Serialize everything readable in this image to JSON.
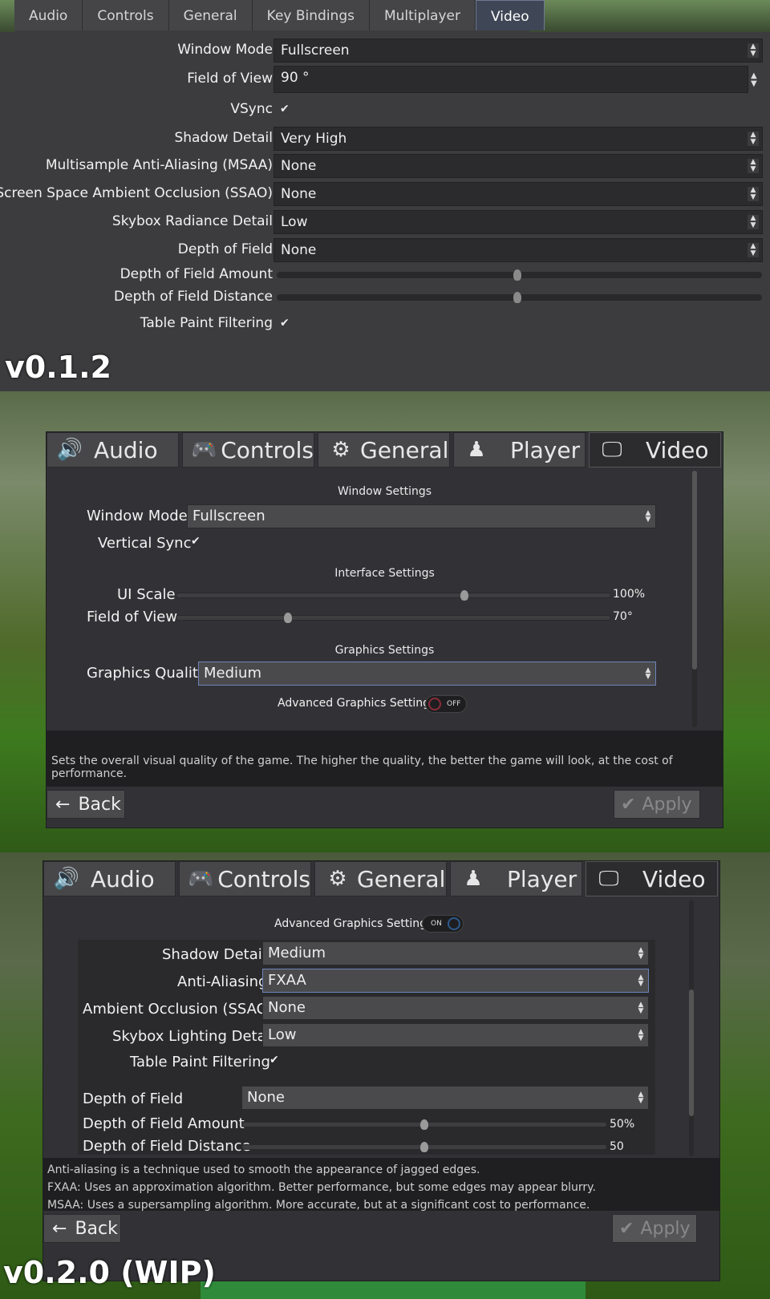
{
  "v1": {
    "tabs": [
      "Audio",
      "Controls",
      "General",
      "Key Bindings",
      "Multiplayer",
      "Video"
    ],
    "rows": {
      "window_mode": {
        "label": "Window Mode",
        "value": "Fullscreen"
      },
      "fov": {
        "label": "Field of View",
        "value": "90 °"
      },
      "vsync": {
        "label": "VSync",
        "checked": true
      },
      "shadow": {
        "label": "Shadow Detail",
        "value": "Very High"
      },
      "msaa": {
        "label": "Multisample Anti-Aliasing (MSAA)",
        "value": "None"
      },
      "ssao": {
        "label": "Screen Space Ambient Occlusion (SSAO)",
        "value": "None"
      },
      "skybox": {
        "label": "Skybox Radiance Detail",
        "value": "Low"
      },
      "dof": {
        "label": "Depth of Field",
        "value": "None"
      },
      "dof_amount": {
        "label": "Depth of Field Amount",
        "level": 0.5
      },
      "dof_distance": {
        "label": "Depth of Field Distance",
        "level": 0.5
      },
      "table_paint": {
        "label": "Table Paint Filtering",
        "checked": true
      }
    },
    "version": "v0.1.2"
  },
  "v2": {
    "tabs": [
      "Audio",
      "Controls",
      "General",
      "Player",
      "Video"
    ],
    "window_settings": "Window Settings",
    "window_mode": {
      "label": "Window Mode",
      "value": "Fullscreen"
    },
    "vsync": {
      "label": "Vertical Sync",
      "checked": true
    },
    "interface_settings": "Interface Settings",
    "ui_scale": {
      "label": "UI Scale",
      "value": "100%",
      "level": 0.66
    },
    "fov": {
      "label": "Field of View",
      "value": "70°",
      "level": 0.25
    },
    "graphics_settings": "Graphics Settings",
    "graphics_quality": {
      "label": "Graphics Quality",
      "value": "Medium"
    },
    "advanced": {
      "label": "Advanced Graphics Settings",
      "state": "OFF"
    },
    "description": "Sets the overall visual quality of the game. The higher the quality, the better the game will look, at the cost of performance.",
    "back": "Back",
    "apply": "Apply"
  },
  "v3": {
    "tabs": [
      "Audio",
      "Controls",
      "General",
      "Player",
      "Video"
    ],
    "advanced": {
      "label": "Advanced Graphics Settings",
      "state": "ON"
    },
    "shadow": {
      "label": "Shadow Detail",
      "value": "Medium"
    },
    "aa": {
      "label": "Anti-Aliasing",
      "value": "FXAA"
    },
    "ssao": {
      "label": "Ambient Occlusion (SSAO)",
      "value": "None"
    },
    "skybox": {
      "label": "Skybox Lighting Detail",
      "value": "Low"
    },
    "table_paint": {
      "label": "Table Paint Filtering",
      "checked": true
    },
    "dof": {
      "label": "Depth of Field",
      "value": "None"
    },
    "dof_amount": {
      "label": "Depth of Field Amount",
      "value": "50%",
      "level": 0.5
    },
    "dof_distance": {
      "label": "Depth of Field Distance",
      "value": "50",
      "level": 0.5
    },
    "description": [
      "Anti-aliasing is a technique used to smooth the appearance of jagged edges.",
      "FXAA: Uses an approximation algorithm. Better performance, but some edges may appear blurry.",
      "MSAA: Uses a supersampling algorithm. More accurate, but at a significant cost to performance."
    ],
    "back": "Back",
    "apply": "Apply",
    "version": "v0.2.0 (WIP)"
  },
  "icons": {
    "audio": "speaker-icon",
    "controls": "gamepad-icon",
    "general": "gear-icon",
    "player": "person-icon",
    "video": "monitor-icon",
    "back": "arrow-left-icon",
    "apply": "checkmark-icon"
  },
  "colors": {
    "panel": "#323236",
    "tab_active_v1": "#3f4655",
    "focus_border": "#6e84b8",
    "toggle_on": "#2d5a8a",
    "toggle_off": "#8a2d3a"
  }
}
